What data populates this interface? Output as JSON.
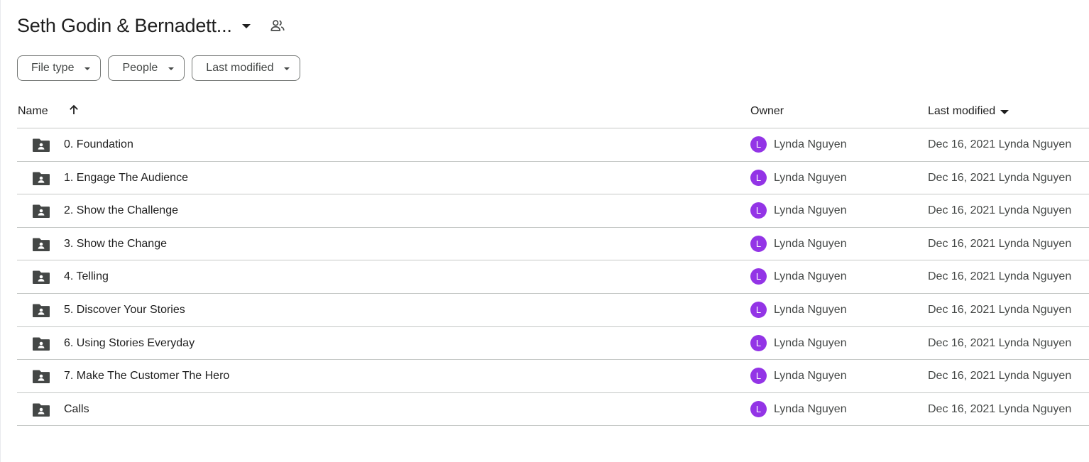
{
  "header": {
    "title": "Seth Godin & Bernadett...",
    "shared_icon": "shared-folder-people-icon"
  },
  "filters": [
    {
      "label": "File type"
    },
    {
      "label": "People"
    },
    {
      "label": "Last modified"
    }
  ],
  "table": {
    "columns": {
      "name": "Name",
      "owner": "Owner",
      "modified": "Last modified"
    },
    "sort": {
      "column": "name",
      "direction": "ascending",
      "icon": "arrow-up-icon"
    },
    "rows": [
      {
        "name": "0. Foundation",
        "owner_initial": "L",
        "owner": "Lynda Nguyen",
        "modified": "Dec 16, 2021 Lynda Nguyen"
      },
      {
        "name": "1. Engage The Audience",
        "owner_initial": "L",
        "owner": "Lynda Nguyen",
        "modified": "Dec 16, 2021 Lynda Nguyen"
      },
      {
        "name": "2. Show the Challenge",
        "owner_initial": "L",
        "owner": "Lynda Nguyen",
        "modified": "Dec 16, 2021 Lynda Nguyen"
      },
      {
        "name": "3. Show the Change",
        "owner_initial": "L",
        "owner": "Lynda Nguyen",
        "modified": "Dec 16, 2021 Lynda Nguyen"
      },
      {
        "name": "4. Telling",
        "owner_initial": "L",
        "owner": "Lynda Nguyen",
        "modified": "Dec 16, 2021 Lynda Nguyen"
      },
      {
        "name": "5. Discover Your Stories",
        "owner_initial": "L",
        "owner": "Lynda Nguyen",
        "modified": "Dec 16, 2021 Lynda Nguyen"
      },
      {
        "name": "6. Using Stories Everyday",
        "owner_initial": "L",
        "owner": "Lynda Nguyen",
        "modified": "Dec 16, 2021 Lynda Nguyen"
      },
      {
        "name": "7. Make The Customer The Hero",
        "owner_initial": "L",
        "owner": "Lynda Nguyen",
        "modified": "Dec 16, 2021 Lynda Nguyen"
      },
      {
        "name": "Calls",
        "owner_initial": "L",
        "owner": "Lynda Nguyen",
        "modified": "Dec 16, 2021 Lynda Nguyen"
      }
    ]
  },
  "colors": {
    "avatar": "#9334e6",
    "text_primary": "#1f1f1f",
    "text_secondary": "#444746",
    "divider": "#c4c7c5",
    "folder_icon": "#444746"
  }
}
